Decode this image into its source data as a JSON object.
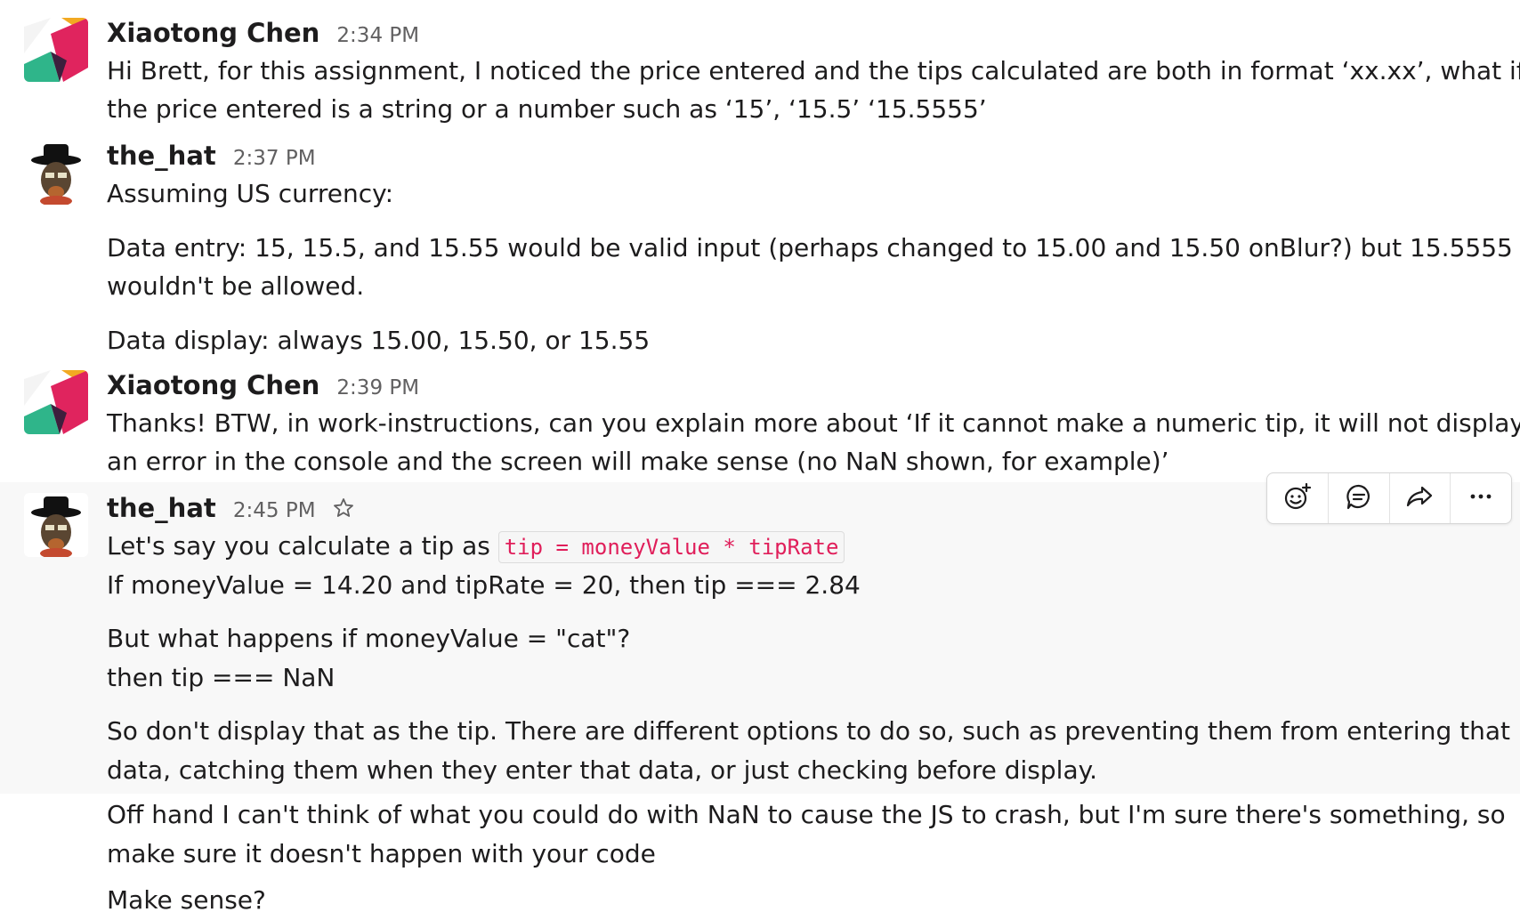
{
  "messages": [
    {
      "sender": "Xiaotong Chen",
      "time": "2:34 PM",
      "avatar": "xiaotong-avatar",
      "lines": [
        "Hi Brett, for this assignment, I noticed the price entered and the tips calculated are both in format ‘xx.xx’, what if",
        "the price entered is a string or a number such as ‘15’, ‘15.5’ ‘15.5555’"
      ]
    },
    {
      "sender": "the_hat",
      "time": "2:37 PM",
      "avatar": "hat-avatar",
      "lines": [
        "Assuming US currency:",
        "Data entry: 15, 15.5, and 15.55 would be valid input (perhaps changed to 15.00 and 15.50 onBlur?) but 15.5555",
        "wouldn't be allowed.",
        "Data display: always 15.00, 15.50, or 15.55"
      ]
    },
    {
      "sender": "Xiaotong Chen",
      "time": "2:39 PM",
      "avatar": "xiaotong-avatar",
      "lines": [
        "Thanks! BTW, in work-instructions, can you explain more about ‘If it cannot make a numeric tip, it will not display",
        "an error in the console and the screen will make sense (no NaN shown, for example)’"
      ]
    },
    {
      "sender": "the_hat",
      "time": "2:45 PM",
      "avatar": "hat-avatar",
      "code_prefix": "Let's say you calculate a tip as",
      "code": "tip = moneyValue * tipRate",
      "lines": [
        "If moneyValue = 14.20 and tipRate = 20, then tip === 2.84",
        "But what happens if moneyValue = \"cat\"?",
        "then tip === NaN",
        "So don't display that as the tip.  There are different options to do so, such as preventing them from entering that",
        "data, catching them when they enter that data, or just checking before display."
      ]
    }
  ],
  "followups": [
    "Off hand I can't think of what you could do with NaN to cause the JS to crash, but I'm sure there's something, so",
    "make sure it doesn't happen with your code",
    "Make sense?"
  ],
  "toolbar": {
    "icons": [
      "add-reaction-icon",
      "reply-thread-icon",
      "share-message-icon",
      "more-actions-icon"
    ]
  },
  "colors": {
    "code_text": "#e01e5a",
    "hover_bg": "#f8f8f8",
    "time_text": "#616061"
  }
}
